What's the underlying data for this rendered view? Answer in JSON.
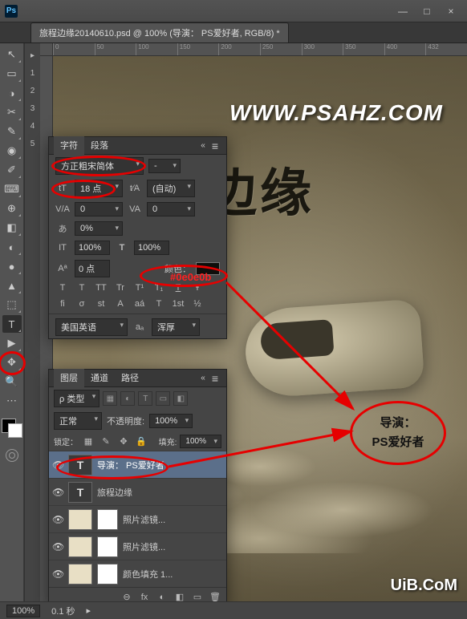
{
  "titlebar": {
    "app": "Ps",
    "minimize": "—",
    "maximize": "□",
    "close": "×"
  },
  "document": {
    "tab_title": "旅程边缘20140610.psd @ 100% (导演： PS爱好者, RGB/8) *"
  },
  "ruler": {
    "marks": [
      "0",
      "50",
      "100",
      "150",
      "200",
      "250",
      "300",
      "350",
      "400",
      "432"
    ]
  },
  "canvas": {
    "watermark": "WWW.PSAHZ.COM",
    "big_title": "边缘",
    "uib": "UiB.CoM",
    "anno_director_label": "导演：",
    "anno_director_value": "PS爱好者"
  },
  "char_panel": {
    "tab_char": "字符",
    "tab_para": "段落",
    "font_family": "方正粗宋简体",
    "font_style": "-",
    "font_size": "18 点",
    "leading_mode": "(自动)",
    "tracking1": "0",
    "tracking2": "0",
    "scale_pct": "0%",
    "vscale": "100%",
    "hscale": "100%",
    "baseline": "0 点",
    "color_label": "颜色：",
    "color_hex": "#0e0e0b",
    "styles": [
      "T",
      "T",
      "TT",
      "Tr",
      "T¹",
      "T₁",
      "T",
      "Ŧ"
    ],
    "ot": [
      "fi",
      "σ",
      "st",
      "A",
      "aá",
      "T",
      "1st",
      "½"
    ],
    "lang": "美国英语",
    "aa_label": "aₐ",
    "aa": "浑厚"
  },
  "layers_panel": {
    "tab_layers": "图层",
    "tab_channels": "通道",
    "tab_paths": "路径",
    "kind_label": "ρ 类型",
    "filters": [
      "▦",
      "◐",
      "T",
      "▭",
      "◧"
    ],
    "blend": "正常",
    "opacity_label": "不透明度:",
    "opacity": "100%",
    "lock_label": "锁定：",
    "lock_icons": [
      "▦",
      "✎",
      "✥",
      "🔒"
    ],
    "fill_label": "填充:",
    "fill": "100%",
    "items": [
      {
        "type": "T",
        "name": "导演： PS爱好者",
        "sel": true
      },
      {
        "type": "T",
        "name": "旅程边缘"
      },
      {
        "type": "fill",
        "name": "照片滤镜..."
      },
      {
        "type": "fill",
        "name": "照片滤镜..."
      },
      {
        "type": "fill",
        "name": "颜色填充 1..."
      }
    ],
    "foot": [
      "⊖",
      "fx",
      "◐",
      "◧",
      "▭",
      "🗑"
    ]
  },
  "status": {
    "zoom": "100%",
    "timing": "0.1 秒"
  },
  "tools": [
    "↖",
    "▭",
    "◑",
    "✂",
    "✎",
    "◉",
    "✐",
    "⌨",
    "⊕",
    "◧",
    "◐",
    "●",
    "▲",
    "⬚",
    "T",
    "▶",
    "✥",
    "🔍",
    "⋯"
  ]
}
